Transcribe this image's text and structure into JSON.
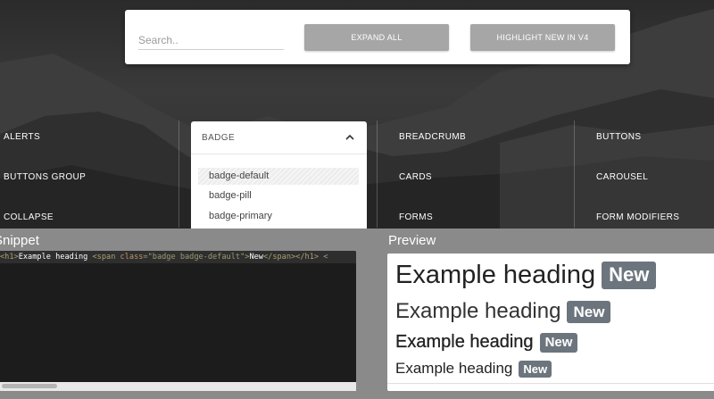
{
  "search": {
    "placeholder": "Search.."
  },
  "toolbar": {
    "expand_label": "EXPAND ALL",
    "highlight_label": "HIGHLIGHT NEW IN V4"
  },
  "nav": {
    "col1": [
      "ALERTS",
      "BUTTONS GROUP",
      "COLLAPSE"
    ],
    "col3": [
      "BREADCRUMB",
      "CARDS",
      "FORMS"
    ],
    "col4": [
      "BUTTONS",
      "CAROUSEL",
      "FORM MODIFIERS"
    ]
  },
  "dropdown": {
    "title": "BADGE",
    "items": [
      "badge-default",
      "badge-pill",
      "badge-primary"
    ],
    "selected": "badge-default"
  },
  "snippet": {
    "title": "Snippet",
    "code": {
      "t1": "<h1>",
      "t2": "Example heading ",
      "t3": "<span ",
      "t4": "class",
      "t5": "=\"badge badge-default\"",
      "t6": ">",
      "t7": "New",
      "t8": "</span></h1>",
      "t9": "  <"
    }
  },
  "preview": {
    "title": "Preview",
    "rows": [
      {
        "heading": "Example heading",
        "badge": "New"
      },
      {
        "heading": "Example heading",
        "badge": "New"
      },
      {
        "heading": "Example heading",
        "badge": "New"
      },
      {
        "heading": "Example heading",
        "badge": "New"
      }
    ]
  },
  "colors": {
    "badge": "#6c757d",
    "button": "#a6a6a6",
    "lower_bg": "#8a8a8a"
  }
}
